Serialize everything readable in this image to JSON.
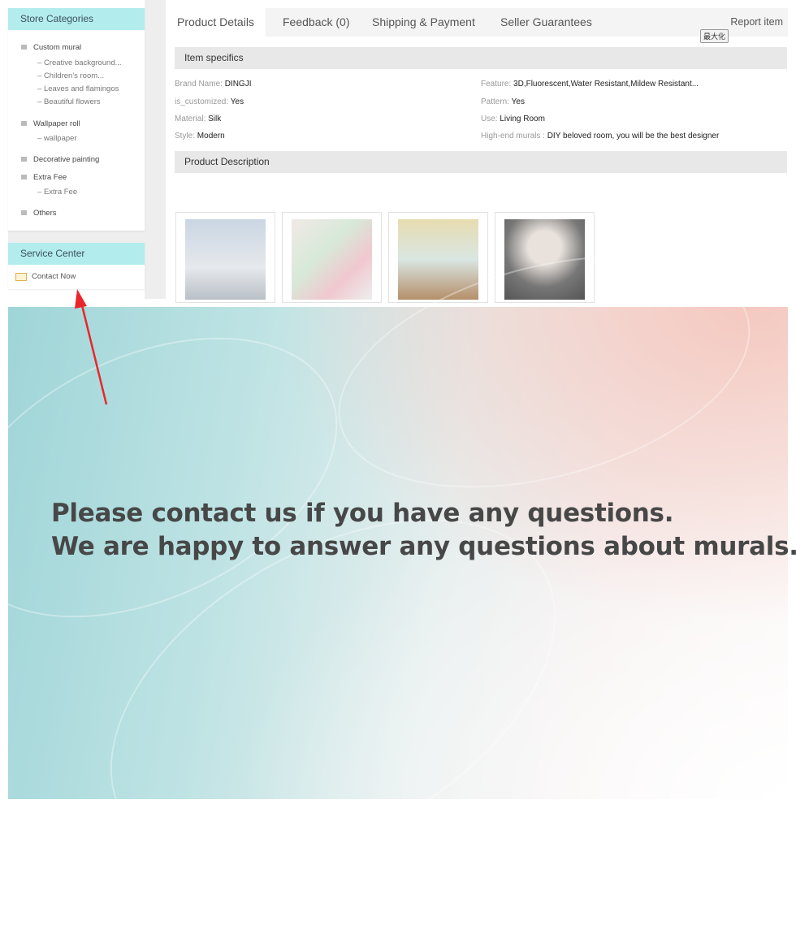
{
  "sidebar": {
    "store_categories_title": "Store Categories",
    "categories": [
      {
        "label": "Custom mural",
        "subs": [
          "Creative background...",
          "Children's room...",
          "Leaves and flamingos",
          "Beautiful flowers"
        ]
      },
      {
        "label": "Wallpaper roll",
        "subs": [
          "wallpaper"
        ]
      },
      {
        "label": "Decorative painting",
        "subs": []
      },
      {
        "label": "Extra Fee",
        "subs": [
          "Extra Fee"
        ]
      },
      {
        "label": "Others",
        "subs": []
      }
    ],
    "service_center_title": "Service Center",
    "contact_now": "Contact Now"
  },
  "tabs": [
    "Product Details",
    "Feedback (0)",
    "Shipping & Payment",
    "Seller Guarantees"
  ],
  "report_item": "Report item",
  "maximize_tooltip": "最大化",
  "item_specifics_title": "Item specifics",
  "specs": [
    {
      "label": "Brand Name:",
      "value": "DINGJI"
    },
    {
      "label": "is_customized:",
      "value": "Yes"
    },
    {
      "label": "Material:",
      "value": "Silk"
    },
    {
      "label": "Style:",
      "value": "Modern"
    },
    {
      "label": "Feature:",
      "value": "3D,Fluorescent,Water Resistant,Mildew Resistant..."
    },
    {
      "label": "Pattern:",
      "value": "Yes"
    },
    {
      "label": "Use:",
      "value": "Living Room"
    },
    {
      "label": "High-end murals :",
      "value": "DIY beloved room, you will be the best designer"
    }
  ],
  "product_description_title": "Product Description",
  "banner": {
    "line1": "Please contact us if you have any questions.",
    "line2": "We are happy to answer any questions about murals."
  },
  "colors": {
    "sidebar_header": "#b3ecec",
    "arrow": "#e8262b"
  }
}
